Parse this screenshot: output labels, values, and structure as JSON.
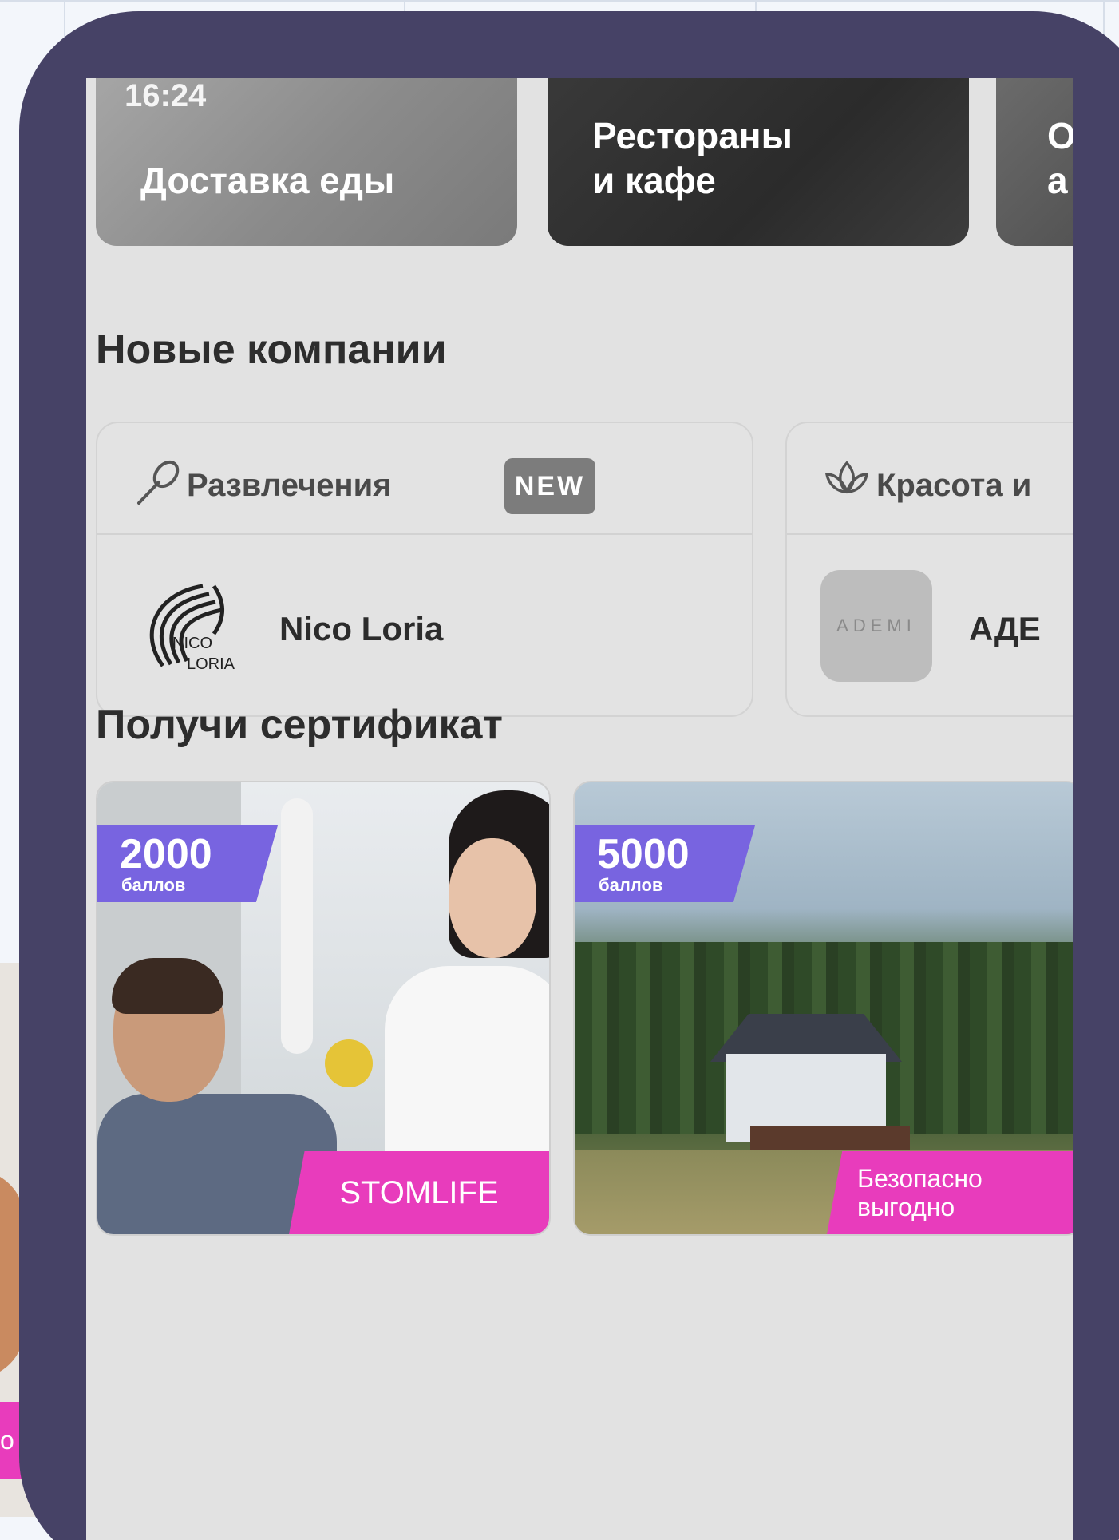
{
  "categories": [
    {
      "label_line1": "Доставка еды",
      "label_line2": "",
      "time": "16:24"
    },
    {
      "label_line1": "Рестораны",
      "label_line2": "и кафе"
    },
    {
      "label_line1": "О",
      "label_line2": "а"
    }
  ],
  "new_companies": {
    "title": "Новые компании",
    "cards": [
      {
        "category": "Развлечения",
        "badge": "NEW",
        "company": "Nico Loria",
        "logo_text_1": "NICO",
        "logo_text_2": "LORIA",
        "icon": "microphone-icon"
      },
      {
        "category": "Красота и",
        "company": "АДЕ",
        "logo_text": "ADEMI",
        "icon": "lotus-icon"
      }
    ]
  },
  "certificates": {
    "title": "Получи сертификат",
    "cards": [
      {
        "points": "2000",
        "unit": "баллов",
        "brand": "STOMLIFE"
      },
      {
        "points": "5000",
        "unit": "баллов",
        "brand_line1": "Безопасно",
        "brand_line2": "выгодно"
      }
    ],
    "left_partial_text": "о"
  },
  "colors": {
    "frame": "#464266",
    "points_tag": "#7864e0",
    "brand_tag": "#e83cbc",
    "screen_bg": "#e2e2e2"
  }
}
